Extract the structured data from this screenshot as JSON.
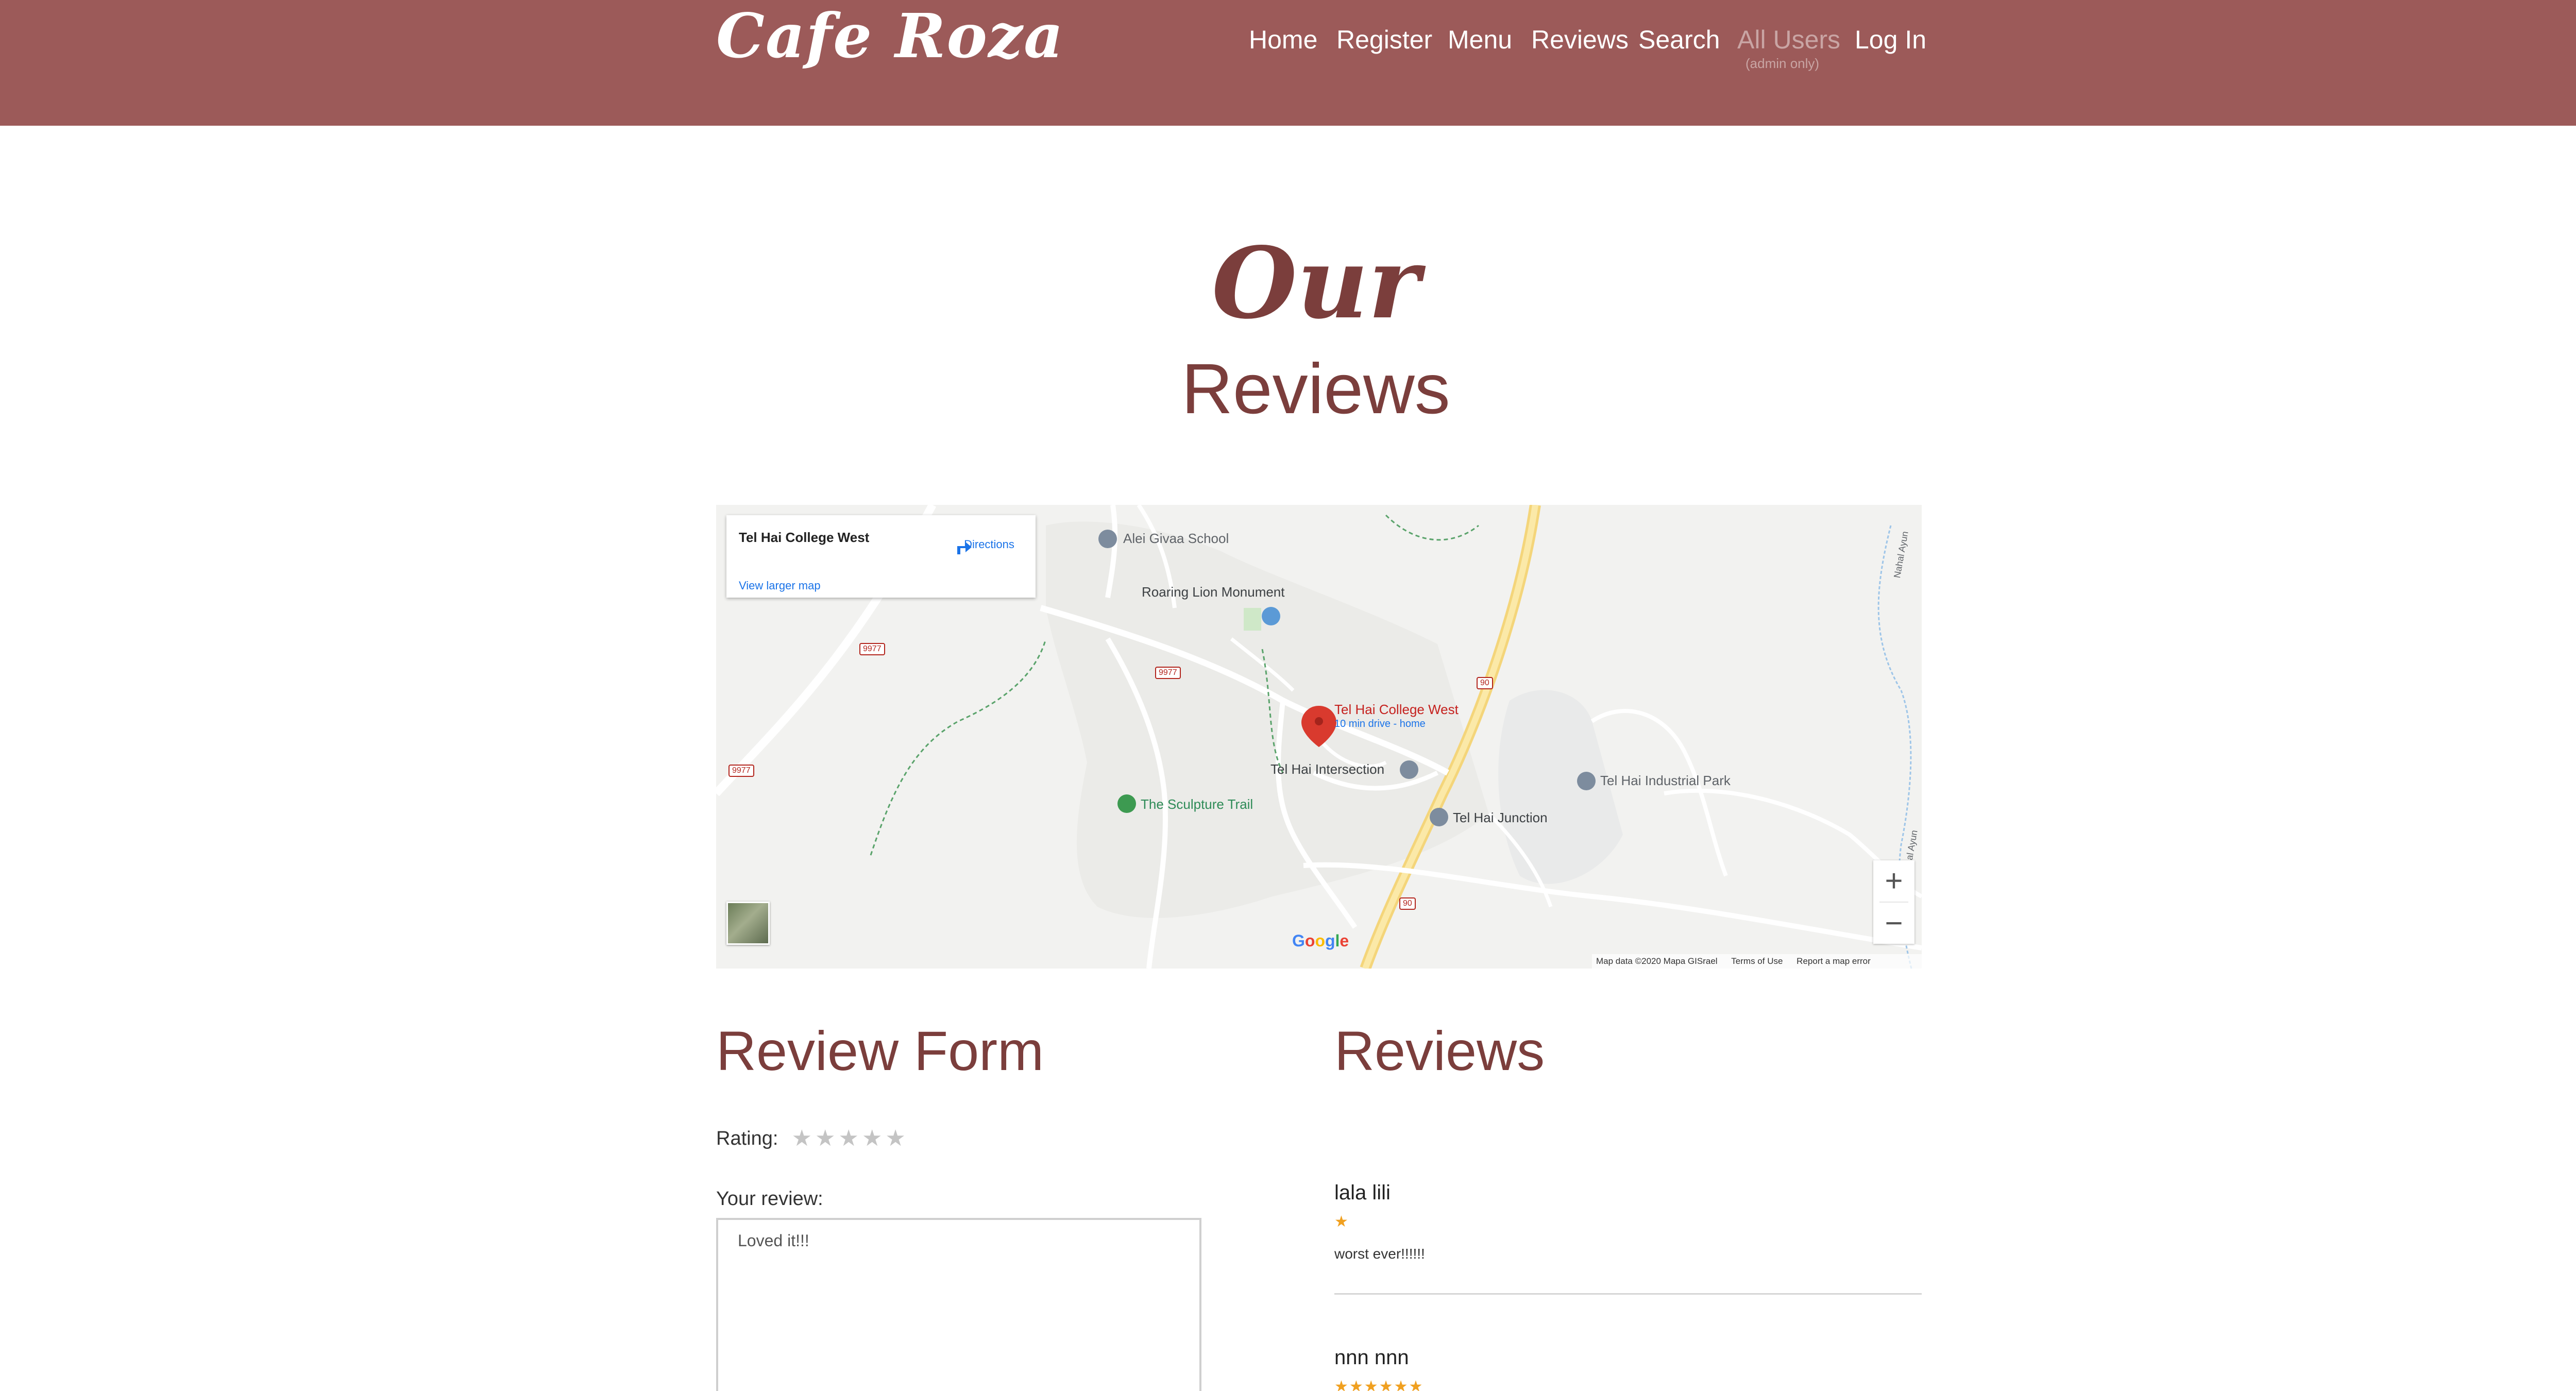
{
  "header": {
    "logo": "Cafe Roza",
    "nav": [
      {
        "label": "Home"
      },
      {
        "label": "Register"
      },
      {
        "label": "Menu"
      },
      {
        "label": "Reviews"
      },
      {
        "label": "Search"
      },
      {
        "label": "All Users",
        "sub": "(admin only)"
      },
      {
        "label": "Log In"
      }
    ]
  },
  "page_title": {
    "script": "Our",
    "main": "Reviews"
  },
  "map": {
    "card_title": "Tel Hai College West",
    "directions_label": "Directions",
    "view_larger": "View larger map",
    "labels": {
      "school": "Alei Givaa School",
      "monument": "Roaring Lion Monument",
      "college": "Tel Hai College West",
      "college_sub": "10 min drive - home",
      "intersection": "Tel Hai Intersection",
      "industrial": "Tel Hai Industrial Park",
      "sculpture": "The Sculpture Trail",
      "junction": "Tel Hai Junction",
      "nahal_top": "Nahal Ayun",
      "nahal_side": "Nahal Ayun"
    },
    "road_badges": [
      "9977",
      "9977",
      "9977",
      "90",
      "90"
    ],
    "zoom_in": "+",
    "zoom_out": "−",
    "google": "Google",
    "footer": {
      "data": "Map data ©2020 Mapa GISrael",
      "terms": "Terms of Use",
      "report": "Report a map error"
    }
  },
  "review_form": {
    "title": "Review Form",
    "rating_label": "Rating:",
    "rating_value": 0,
    "rating_max": 5,
    "review_label": "Your review:",
    "review_value": "Loved it!!!"
  },
  "reviews": {
    "title": "Reviews",
    "items": [
      {
        "name": "lala lili",
        "rating": 1,
        "stars": "★",
        "text": "worst ever!!!!!!"
      },
      {
        "name": "nnn nnn",
        "rating": 6,
        "stars": "★★★★★★",
        "text": ""
      }
    ]
  },
  "colors": {
    "header_bg": "#9c5a59",
    "title": "#7b3e3c",
    "star_active": "#f0a020",
    "star_inactive": "#c4c4c4"
  }
}
